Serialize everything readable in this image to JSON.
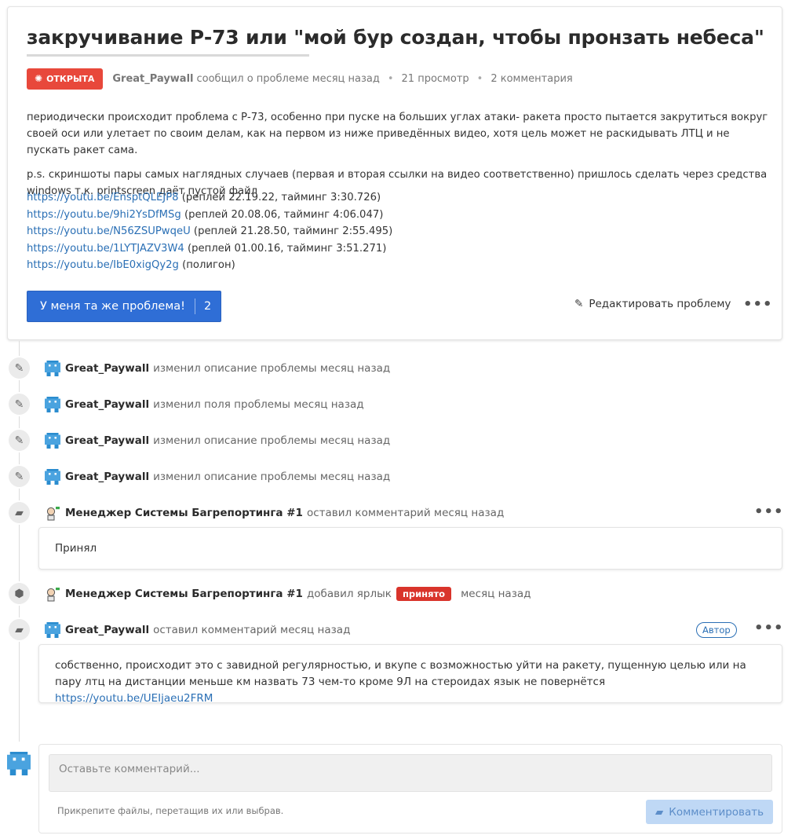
{
  "issue": {
    "title": "закручивание Р-73 или \"мой бур создан, чтобы пронзать небеса\"",
    "status_badge": "ОТКРЫТА",
    "author": "Great_Paywall",
    "reported_text": "сообщил о проблеме месяц назад",
    "views": "21 просмотр",
    "comments_count": "2 комментария",
    "description": [
      "периодически происходит проблема с Р-73, особенно при пуске на больших углах атаки- ракета просто пытается закрутиться вокруг своей оси или улетает по своим делам, как на первом из ниже приведённых видео, хотя цель может не раскидывать ЛТЦ и не пускать ракет сама.",
      "p.s. скриншоты пары самых наглядных случаев (первая и вторая ссылки на видео соответственно) пришлось сделать через средства windows т.к. printscreen даёт пустой файл"
    ],
    "links": [
      {
        "url": "https://youtu.be/EnsptQLEJP8",
        "note": " (реплей 22.19.22, тайминг 3:30.726)"
      },
      {
        "url": "https://youtu.be/9hi2YsDfMSg",
        "note": " (реплей 20.08.06, тайминг 4:06.047)"
      },
      {
        "url": "https://youtu.be/N56ZSUPwqeU",
        "note": " (реплей 21.28.50, тайминг 2:55.495)"
      },
      {
        "url": "https://youtu.be/1LYTJAZV3W4",
        "note": " (реплей 01.00.16, тайминг 3:51.271)"
      },
      {
        "url": "https://youtu.be/IbE0xigQy2g",
        "note": " (полигон)"
      }
    ],
    "same_problem_label": "У меня та же проблема!",
    "same_problem_count": "2",
    "edit_label": "Редактировать проблему",
    "more_label": "•••"
  },
  "timeline": {
    "events": [
      {
        "author": "Great_Paywall",
        "text": "изменил описание проблемы месяц назад"
      },
      {
        "author": "Great_Paywall",
        "text": "изменил поля проблемы месяц назад"
      },
      {
        "author": "Great_Paywall",
        "text": "изменил описание проблемы месяц назад"
      },
      {
        "author": "Great_Paywall",
        "text": "изменил описание проблемы месяц назад"
      }
    ],
    "comment1": {
      "author": "Менеджер Системы Багрепортинга #1",
      "text": "оставил комментарий месяц назад",
      "body": "Принял"
    },
    "label_event": {
      "author": "Менеджер Системы Багрепортинга #1",
      "text": "добавил ярлык",
      "tag": "принято",
      "time": "месяц назад"
    },
    "comment2": {
      "author": "Great_Paywall",
      "text": "оставил комментарий месяц назад",
      "author_badge": "Автор",
      "body": "собственно, происходит это с завидной регулярностью, и вкупе с возможностью уйти на ракету, пущенную целью или на пару лтц на дистанции меньше км назвать 73 чем-то кроме 9Л на стероидах язык не повернётся ",
      "link": "https://youtu.be/UEIjaeu2FRM"
    }
  },
  "new_comment": {
    "placeholder": "Оставьте комментарий...",
    "attach_hint": "Прикрепите файлы, перетащив их или выбрав.",
    "submit_label": "Комментировать"
  },
  "colors": {
    "open_badge": "#e8483b",
    "primary_button": "#2f6ed6",
    "link": "#2a6fb5",
    "accepted_tag": "#d9342b",
    "disabled_button": "#bfd8f5"
  }
}
